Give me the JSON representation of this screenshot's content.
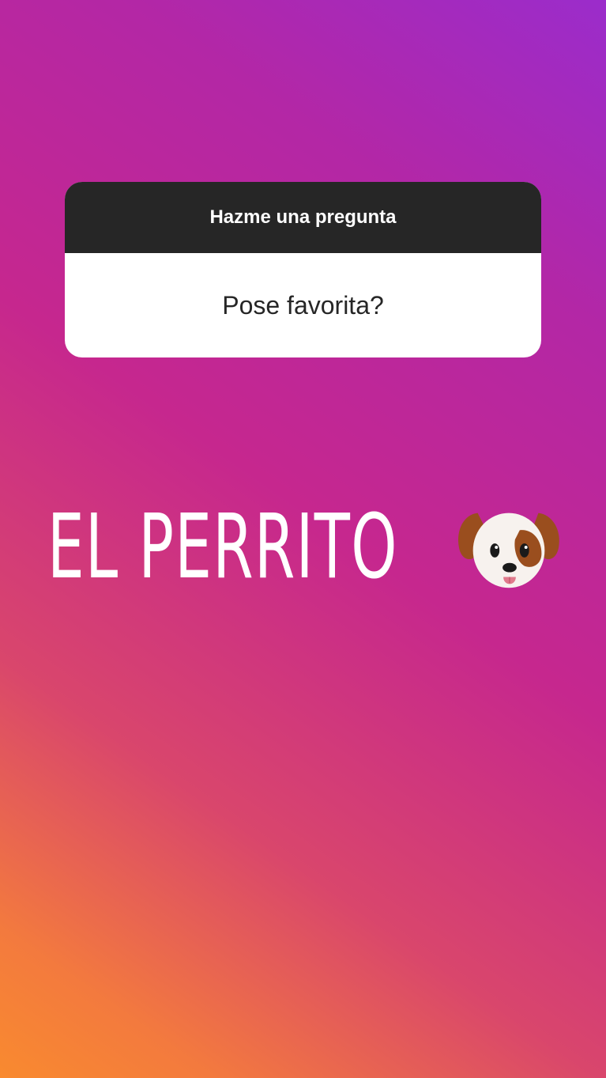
{
  "colors": {
    "gradient_top": "#9b2ccb",
    "gradient_mid": "#c6278e",
    "gradient_bottom": "#f98a2f",
    "card_header": "#262626",
    "card_body": "#ffffff"
  },
  "question_sticker": {
    "header": "Hazme una pregunta",
    "question": "Pose favorita?"
  },
  "answer": {
    "text": "EL PERRITO",
    "emoji": "dog-face-icon"
  }
}
